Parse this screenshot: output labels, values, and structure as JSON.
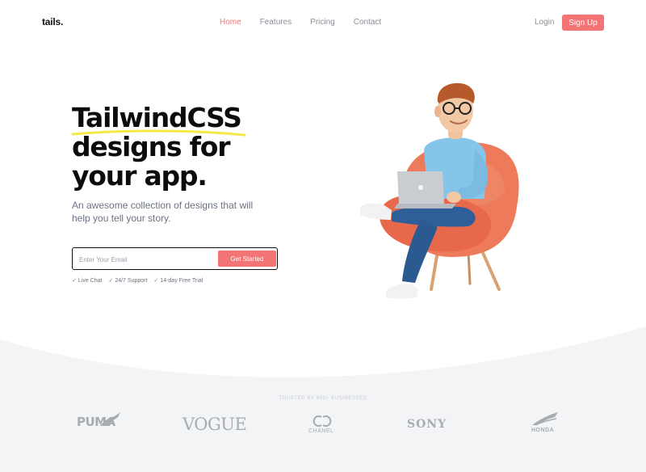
{
  "header": {
    "logo": "tails.",
    "nav": [
      {
        "label": "Home",
        "active": true
      },
      {
        "label": "Features",
        "active": false
      },
      {
        "label": "Pricing",
        "active": false
      },
      {
        "label": "Contact",
        "active": false
      }
    ],
    "login_label": "Login",
    "signup_label": "Sign Up"
  },
  "hero": {
    "title_lines": [
      "TailwindCSS",
      "designs for",
      "your app."
    ],
    "subtitle": "An awesome collection of designs that will help you tell your story.",
    "email_placeholder": "Enter Your Email",
    "cta_label": "Get Started",
    "features": [
      "Live Chat",
      "24/7 Support",
      "14-day Free Trial"
    ]
  },
  "trusted": {
    "heading": "TRUSTED BY 400+ BUSINESSES",
    "brands": [
      "PUMA",
      "VOGUE",
      "CHANEL",
      "SONY",
      "HONDA"
    ]
  },
  "colors": {
    "accent": "#f27474",
    "text_dark": "#0c0c0f",
    "text_muted": "#6b7280",
    "section_bg": "#f3f4f6"
  },
  "icons": {
    "feature_check": "check-icon",
    "underline": "highlight-underline-icon"
  }
}
